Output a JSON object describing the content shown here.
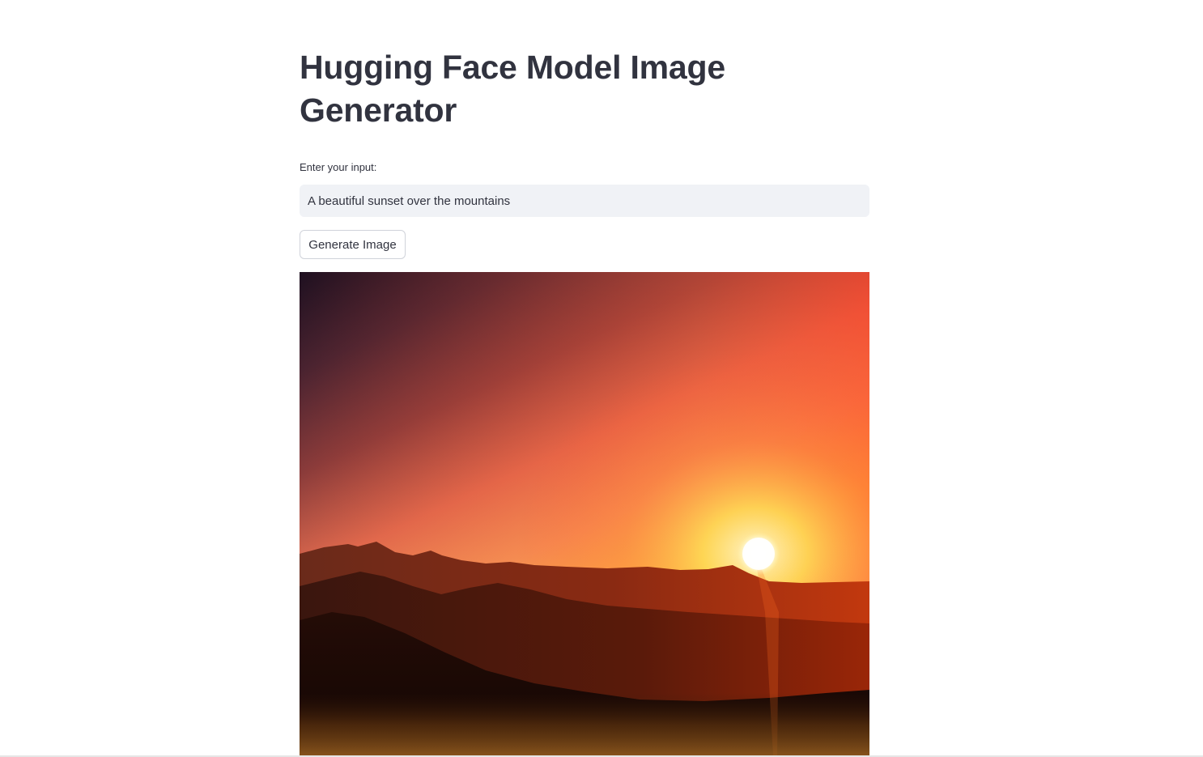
{
  "page": {
    "title": "Hugging Face Model Image Generator"
  },
  "form": {
    "input_label": "Enter your input:",
    "input_value": "A beautiful sunset over the mountains",
    "button_label": "Generate Image"
  },
  "colors": {
    "text": "#31333f",
    "input_background": "#f0f2f6",
    "button_border": "#d0d3da"
  }
}
